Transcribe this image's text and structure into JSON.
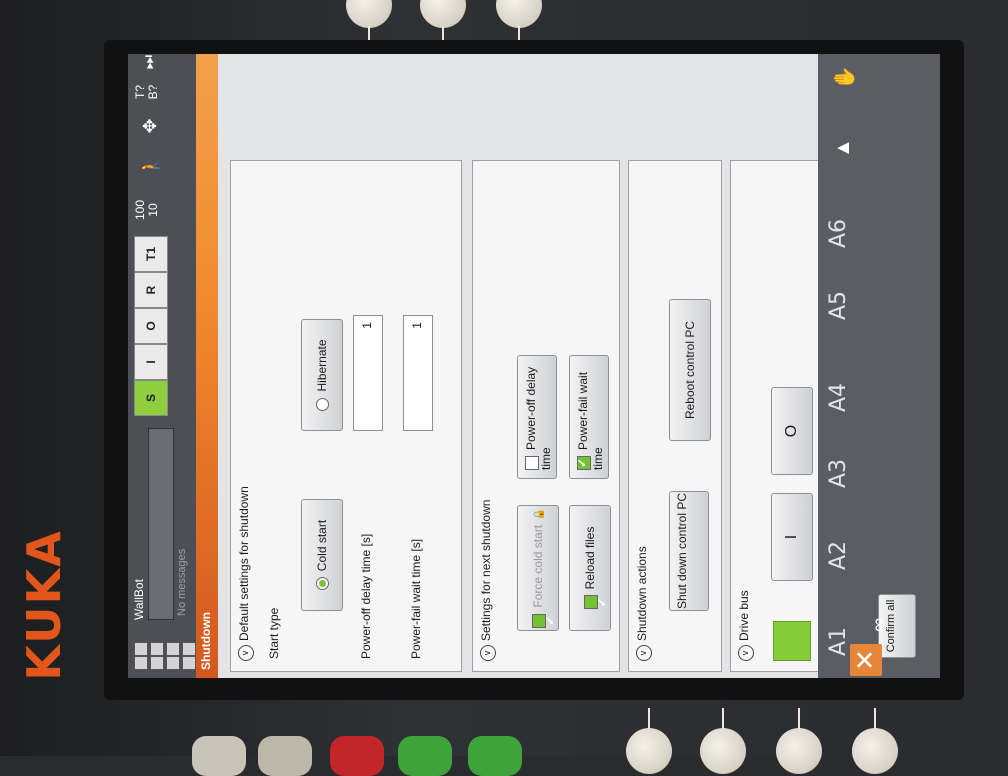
{
  "device": {
    "brand": "KUKA"
  },
  "statusbar": {
    "robot_name": "WallBot",
    "messages": "No messages",
    "mode_s": "S",
    "mode_i": "I",
    "mode_o": "O",
    "mode_r": "R",
    "mode_t1": "T1",
    "override_top": "100",
    "override_bottom": "10",
    "tool_line1": "T?",
    "tool_line2": "B?",
    "infinity": "∞"
  },
  "view": {
    "title": "Shutdown",
    "confirm_all": "Confirm all"
  },
  "defaults": {
    "title": "Default settings for shutdown",
    "start_type_label": "Start type",
    "cold_start": "Cold start",
    "hibernate": "Hibernate",
    "power_off_delay_label": "Power-off delay time [s]",
    "power_off_delay_value": "1",
    "power_fail_wait_label": "Power-fail wait time [s]",
    "power_fail_wait_value": "1"
  },
  "next_shutdown": {
    "title": "Settings for next shutdown",
    "force_cold_start": "Force cold start",
    "power_off_delay_time": "Power-off delay time",
    "reload_files": "Reload files",
    "power_fail_wait_time": "Power-fail wait time"
  },
  "actions": {
    "title": "Shutdown actions",
    "shut_down": "Shut down control PC",
    "reboot": "Reboot control PC"
  },
  "drive_bus": {
    "title": "Drive bus",
    "on": "I",
    "off": "O"
  },
  "axes": [
    "A1",
    "A2",
    "A3",
    "A4",
    "A5",
    "A6"
  ]
}
